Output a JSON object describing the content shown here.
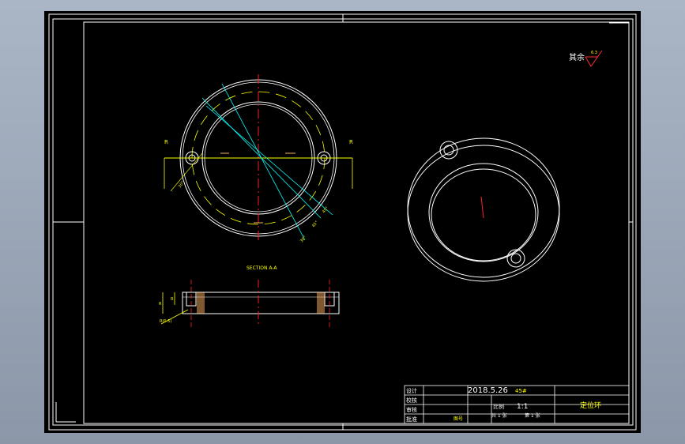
{
  "colors": {
    "background": "#000000",
    "outline": "#ffffff",
    "center_line": "#ff2020",
    "dimension": "#ffff00",
    "section_line": "#00ffff",
    "hatch": "#ffb060",
    "title_text": "#ffffff",
    "title_text_accent": "#ffff00"
  },
  "surface_note": {
    "text": "其余",
    "roughness_value": "6.3"
  },
  "top_view": {
    "side_letter_left": "R",
    "side_letter_right": "R",
    "angle_dim_1": "45°",
    "angle_dim_2": "45°",
    "angle_dim_3": "30°",
    "angle_dim_4": "30°"
  },
  "section_view": {
    "title": "SECTION A-A",
    "dim_height": "R",
    "dim_inner": "R",
    "dim_chamfer": "R(0.5)"
  },
  "title_block": {
    "row_labels": [
      "设计",
      "校核",
      "审核",
      "批准"
    ],
    "date": "2018.5.26",
    "material": "45#",
    "scale_label": "比例",
    "scale_value": "1:1",
    "sheet_label": "共 1 张",
    "sheet_of": "第 1 张",
    "part_name": "定位环",
    "drawing_no_label": "图号"
  }
}
